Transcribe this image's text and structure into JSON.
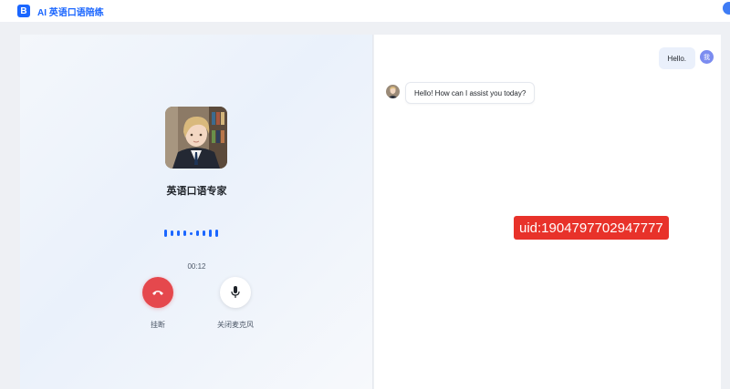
{
  "app": {
    "logo_letter": "B",
    "title": "AI 英语口语陪练"
  },
  "call": {
    "agent_name": "英语口语专家",
    "timer": "00:12",
    "hangup_label": "挂断",
    "mic_label": "关闭麦克风",
    "hangup_color": "#e5484d",
    "accent_color": "#1a66ff",
    "wave_levels": [
      0.8,
      0.6,
      0.6,
      0.6,
      0.3,
      0.6,
      0.6,
      0.8,
      0.8
    ]
  },
  "chat": {
    "messages": [
      {
        "role": "user",
        "text": "Hello.",
        "avatar_initial": "我"
      },
      {
        "role": "assistant",
        "text": "Hello! How can I assist you today?"
      }
    ]
  },
  "overlay": {
    "uid": "uid:1904797702947777",
    "color": "#e8322a"
  },
  "icons": {
    "hangup": "phone-hangup-icon",
    "mic": "microphone-icon"
  }
}
